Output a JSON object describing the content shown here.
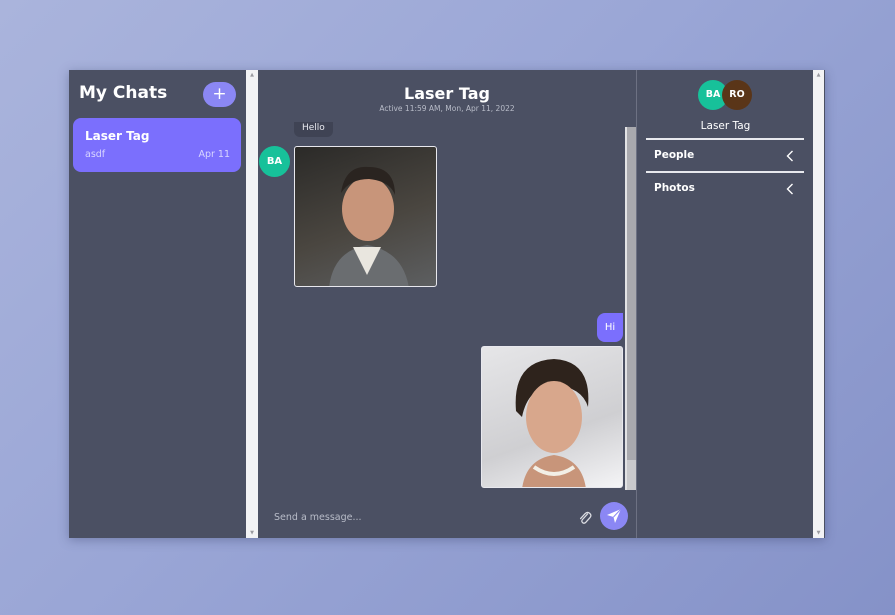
{
  "sidebar": {
    "title": "My Chats",
    "add_label": "+",
    "chats": [
      {
        "title": "Laser Tag",
        "last_message": "asdf",
        "date": "Apr 11"
      }
    ]
  },
  "chat": {
    "title": "Laser Tag",
    "subtitle": "Active 11:59 AM, Mon, Apr 11, 2022",
    "messages": [
      {
        "sender_initials": "BA",
        "text": "Hello"
      },
      {
        "text": "Hi"
      }
    ],
    "composer": {
      "placeholder": "Send a message..."
    }
  },
  "details": {
    "members": [
      "BA",
      "RO"
    ],
    "chat_name": "Laser Tag",
    "sections": [
      {
        "label": "People"
      },
      {
        "label": "Photos"
      }
    ]
  },
  "colors": {
    "accent": "#7b6ffd",
    "panel": "#4b5063",
    "avatar_ba": "#17c19a",
    "avatar_ro": "#5a3518"
  }
}
